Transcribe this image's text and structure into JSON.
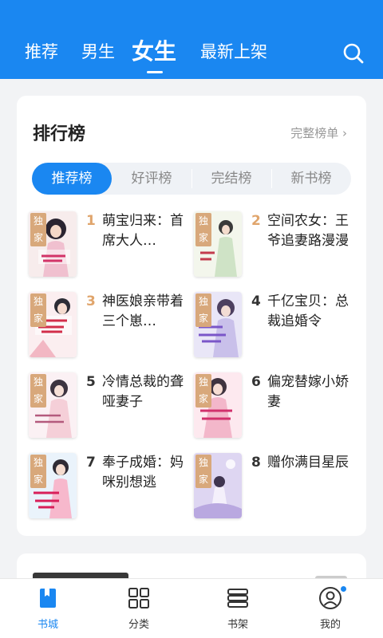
{
  "header": {
    "tabs": [
      {
        "label": "推荐",
        "active": false
      },
      {
        "label": "男生",
        "active": false
      },
      {
        "label": "女生",
        "active": true
      },
      {
        "label": "最新上架",
        "active": false
      }
    ],
    "search_icon": "search-icon"
  },
  "ranking": {
    "title": "排行榜",
    "full_link": "完整榜单 ›",
    "segments": [
      {
        "label": "推荐榜",
        "active": true
      },
      {
        "label": "好评榜",
        "active": false
      },
      {
        "label": "完结榜",
        "active": false
      },
      {
        "label": "新书榜",
        "active": false
      }
    ],
    "books": [
      {
        "rank": "1",
        "title": "萌宝归来：首席大人…",
        "badge": "独家"
      },
      {
        "rank": "2",
        "title": "空间农女：王爷追妻路漫漫",
        "badge": "独家"
      },
      {
        "rank": "3",
        "title": "神医娘亲带着三个崽…",
        "badge": "独家"
      },
      {
        "rank": "4",
        "title": "千亿宝贝：总裁追婚令",
        "badge": "独家"
      },
      {
        "rank": "5",
        "title": "冷情总裁的聋哑妻子",
        "badge": "独家"
      },
      {
        "rank": "6",
        "title": "偏宠替嫁小娇妻",
        "badge": "独家"
      },
      {
        "rank": "7",
        "title": "奉子成婚：妈咪别想逃",
        "badge": "独家"
      },
      {
        "rank": "8",
        "title": "赠你满目星辰",
        "badge": "独家"
      }
    ]
  },
  "bottom_nav": [
    {
      "label": "书城",
      "icon": "bookstore-icon",
      "active": true
    },
    {
      "label": "分类",
      "icon": "category-grid-icon",
      "active": false
    },
    {
      "label": "书架",
      "icon": "bookshelf-icon",
      "active": false
    },
    {
      "label": "我的",
      "icon": "profile-icon",
      "active": false
    }
  ],
  "colors": {
    "brand_blue": "#1a87f1",
    "rank_top": "#e0a56c",
    "badge": "#d8a87b"
  }
}
